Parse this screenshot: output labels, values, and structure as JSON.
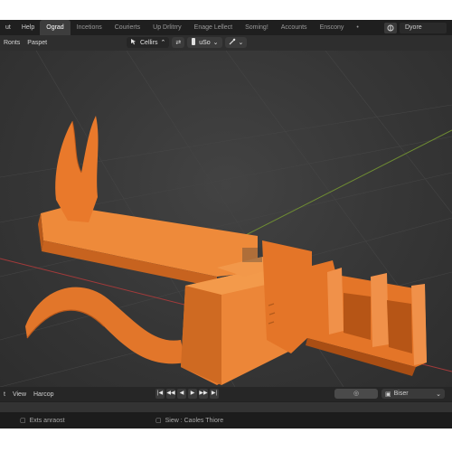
{
  "menubar": {
    "menus": [
      "ut",
      "Help"
    ],
    "workspaces": [
      "Ograd",
      "Incetions",
      "Courierts",
      "Up Drlitrry",
      "Enage Lellect",
      "Soming!",
      "Accounts",
      "Enscony"
    ],
    "active_workspace": "Ograd",
    "more_icon": "•",
    "scene_icon": "scene-icon",
    "scene_name": "Dyore"
  },
  "header": {
    "menus": [
      "Ronts",
      "Paspet"
    ],
    "mode_label": "Cellirs",
    "mode_icon": "cursor-icon",
    "pivot_label": "⇄",
    "snap_label": "uSo"
  },
  "timeline": {
    "menus": [
      "t",
      "View",
      "Harcop"
    ],
    "playback_buttons": [
      "|◀",
      "◀◀",
      "◀",
      "▶",
      "▶▶",
      "▶|"
    ],
    "frame_placeholder": "",
    "render_label": "Biser"
  },
  "statusbar": {
    "left_text": "Exts anraost",
    "middle_text": "Siew : Caoles Thiore"
  },
  "colors": {
    "model_orange": "#e8792a",
    "viewport_bg": "#383838",
    "grid_red": "#b23a3a",
    "grid_green": "#7a9a3a"
  }
}
